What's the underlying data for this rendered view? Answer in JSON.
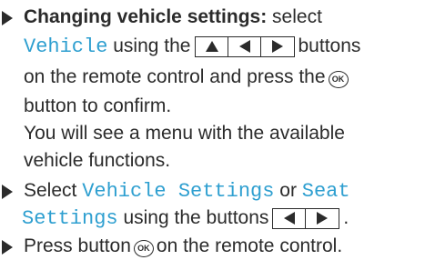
{
  "steps": [
    {
      "title": "Changing vehicle settings:",
      "t1": " select",
      "highlight1": "Vehicle",
      "t2": " using the",
      "t3": "buttons",
      "t4": "on the remote control and press the",
      "ok_label": "OK",
      "t5": "button to confirm.",
      "t6": "You will see a menu with the available",
      "t7": "vehicle functions."
    },
    {
      "t1": "Select ",
      "highlight1": "Vehicle Settings",
      "t2": " or ",
      "highlight2a": "Seat",
      "highlight2b": "Settings",
      "t3": " using the buttons"
    },
    {
      "t1": "Press button",
      "ok_label": "OK",
      "t2": "on the remote control."
    }
  ],
  "buttons": {
    "step1": [
      "up-arrow-icon",
      "left-arrow-icon",
      "right-arrow-icon"
    ],
    "step2": [
      "left-arrow-icon",
      "right-arrow-icon"
    ]
  },
  "colors": {
    "text": "#2b2b2b",
    "highlight": "#2e9fd0"
  }
}
